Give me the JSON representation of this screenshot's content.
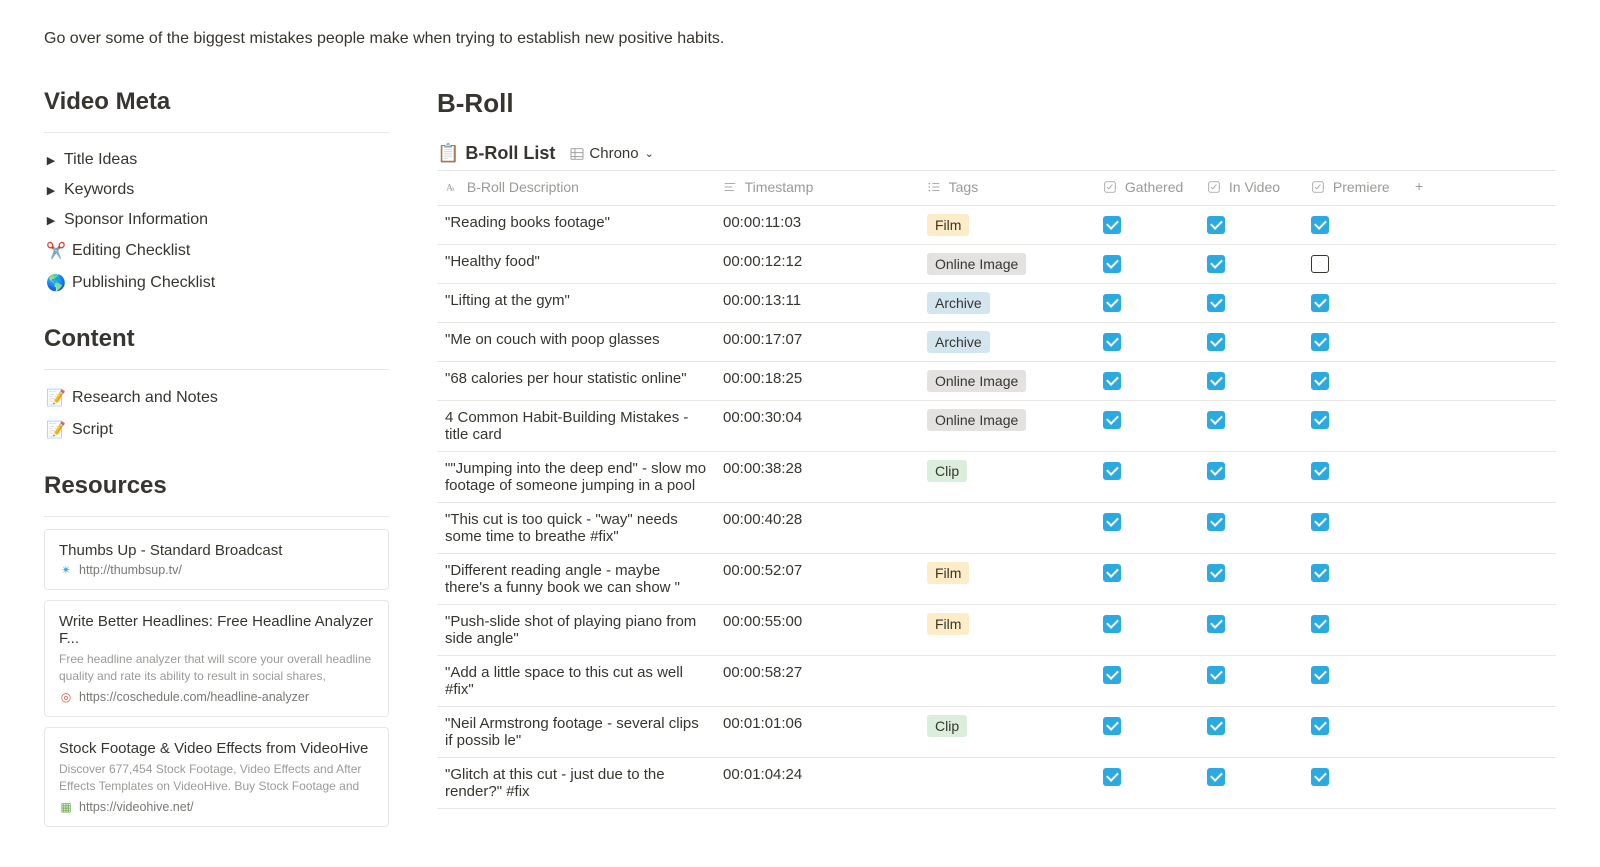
{
  "page_description": "Go over some of the biggest mistakes people make when trying to establish new positive habits.",
  "left": {
    "section_video_meta": "Video Meta",
    "section_content": "Content",
    "section_resources": "Resources",
    "items": {
      "title_ideas": "Title Ideas",
      "keywords": "Keywords",
      "sponsor_info": "Sponsor Information",
      "editing_checklist": "Editing Checklist",
      "publishing_checklist": "Publishing Checklist",
      "research_notes": "Research and Notes",
      "script": "Script"
    },
    "icons": {
      "scissors": "✂️",
      "globe": "🌎",
      "pencil": "📝"
    },
    "resources": [
      {
        "title": "Thumbs Up - Standard Broadcast",
        "desc": "",
        "url": "http://thumbsup.tv/",
        "favicon": "✴",
        "favicon_color": "#2ba9e1"
      },
      {
        "title": "Write Better Headlines: Free Headline Analyzer F...",
        "desc": "Free headline analyzer that will score your overall headline quality and rate its ability to result in social shares,",
        "url": "https://coschedule.com/headline-analyzer",
        "favicon": "◎",
        "favicon_color": "#e55a3c"
      },
      {
        "title": "Stock Footage & Video Effects from VideoHive",
        "desc": "Discover 677,454 Stock Footage, Video Effects and After Effects Templates on VideoHive. Buy Stock Footage and",
        "url": "https://videohive.net/",
        "favicon": "▦",
        "favicon_color": "#6aa84f"
      }
    ]
  },
  "right": {
    "heading": "B-Roll",
    "db_icon": "🗒️",
    "db_title": "B-Roll List",
    "view_name": "Chrono",
    "columns": {
      "desc": "B-Roll Description",
      "timestamp": "Timestamp",
      "tags": "Tags",
      "gathered": "Gathered",
      "in_video": "In Video",
      "premiere": "Premiere"
    },
    "rows": [
      {
        "desc": "\"Reading books footage\"",
        "ts": "00:00:11:03",
        "tag": "Film",
        "tag_class": "tag-film",
        "g": true,
        "v": true,
        "p": true
      },
      {
        "desc": "\"Healthy food\"",
        "ts": "00:00:12:12",
        "tag": "Online Image",
        "tag_class": "tag-online-image",
        "g": true,
        "v": true,
        "p": false
      },
      {
        "desc": "\"Lifting at the gym\"",
        "ts": "00:00:13:11",
        "tag": "Archive",
        "tag_class": "tag-archive",
        "g": true,
        "v": true,
        "p": true
      },
      {
        "desc": "\"Me on couch with poop glasses",
        "ts": "00:00:17:07",
        "tag": "Archive",
        "tag_class": "tag-archive",
        "g": true,
        "v": true,
        "p": true
      },
      {
        "desc": "\"68 calories per hour statistic online\"",
        "ts": "00:00:18:25",
        "tag": "Online Image",
        "tag_class": "tag-online-image",
        "g": true,
        "v": true,
        "p": true
      },
      {
        "desc": "4 Common Habit-Building Mistakes - title card",
        "ts": "00:00:30:04",
        "tag": "Online Image",
        "tag_class": "tag-online-image",
        "g": true,
        "v": true,
        "p": true
      },
      {
        "desc": "\"\"Jumping into the deep end\" - slow mo footage of someone jumping in a pool",
        "ts": "00:00:38:28",
        "tag": "Clip",
        "tag_class": "tag-clip",
        "g": true,
        "v": true,
        "p": true
      },
      {
        "desc": "\"This cut is too quick - \"way\" needs some time to breathe #fix\"",
        "ts": "00:00:40:28",
        "tag": "",
        "tag_class": "",
        "g": true,
        "v": true,
        "p": true
      },
      {
        "desc": "\"Different reading angle - maybe there's a funny book we can show \"",
        "ts": "00:00:52:07",
        "tag": "Film",
        "tag_class": "tag-film",
        "g": true,
        "v": true,
        "p": true
      },
      {
        "desc": "\"Push-slide shot of playing piano from side angle\"",
        "ts": "00:00:55:00",
        "tag": "Film",
        "tag_class": "tag-film",
        "g": true,
        "v": true,
        "p": true
      },
      {
        "desc": "\"Add a little space to this cut as well #fix\"",
        "ts": "00:00:58:27",
        "tag": "",
        "tag_class": "",
        "g": true,
        "v": true,
        "p": true
      },
      {
        "desc": "\"Neil Armstrong footage - several clips if possib le\"",
        "ts": "00:01:01:06",
        "tag": "Clip",
        "tag_class": "tag-clip",
        "g": true,
        "v": true,
        "p": true
      },
      {
        "desc": "\"Glitch at this cut - just due to the render?\" #fix",
        "ts": "00:01:04:24",
        "tag": "",
        "tag_class": "",
        "g": true,
        "v": true,
        "p": true
      }
    ]
  }
}
